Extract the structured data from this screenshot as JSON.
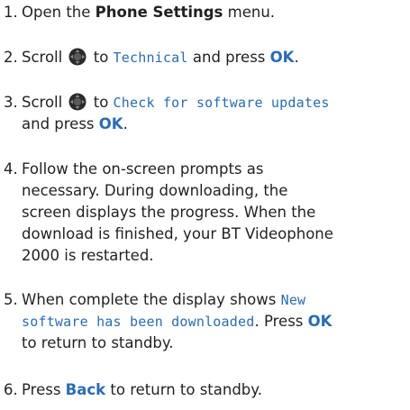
{
  "steps": [
    {
      "number": "1.",
      "lines": [
        [
          {
            "t": "Open the "
          },
          {
            "t": "Phone Settings",
            "s": "bold"
          },
          {
            "t": " menu."
          }
        ]
      ]
    },
    {
      "number": "2.",
      "lines": [
        [
          {
            "t": "Scroll "
          },
          {
            "icon": "navigation-joystick-icon"
          },
          {
            "t": " to "
          },
          {
            "t": "Technical",
            "s": "lcd"
          },
          {
            "t": " and press "
          },
          {
            "t": "OK",
            "s": "bold blue"
          },
          {
            "t": "."
          }
        ]
      ]
    },
    {
      "number": "3.",
      "lines": [
        [
          {
            "t": "Scroll "
          },
          {
            "icon": "navigation-joystick-icon"
          },
          {
            "t": " to "
          },
          {
            "t": "Check for software updates",
            "s": "lcd"
          }
        ],
        [
          {
            "t": "and press "
          },
          {
            "t": "OK",
            "s": "bold blue"
          },
          {
            "t": "."
          }
        ]
      ]
    },
    {
      "number": "4.",
      "lines": [
        [
          {
            "t": "Follow the on-screen prompts as"
          }
        ],
        [
          {
            "t": "necessary. During downloading, the"
          }
        ],
        [
          {
            "t": "screen displays the progress. When the"
          }
        ],
        [
          {
            "t": "download is finished, your BT Videophone"
          }
        ],
        [
          {
            "t": "2000 is restarted."
          }
        ]
      ]
    },
    {
      "number": "5.",
      "lines": [
        [
          {
            "t": "When complete the display shows "
          },
          {
            "t": "New",
            "s": "lcd"
          }
        ],
        [
          {
            "t": "software has been downloaded",
            "s": "lcd"
          },
          {
            "t": ". Press "
          },
          {
            "t": "OK",
            "s": "bold blue"
          }
        ],
        [
          {
            "t": "to return to standby."
          }
        ]
      ]
    },
    {
      "number": "6.",
      "lines": [
        [
          {
            "t": "Press "
          },
          {
            "t": "Back",
            "s": "bold blue"
          },
          {
            "t": " to return to standby."
          }
        ]
      ]
    }
  ]
}
